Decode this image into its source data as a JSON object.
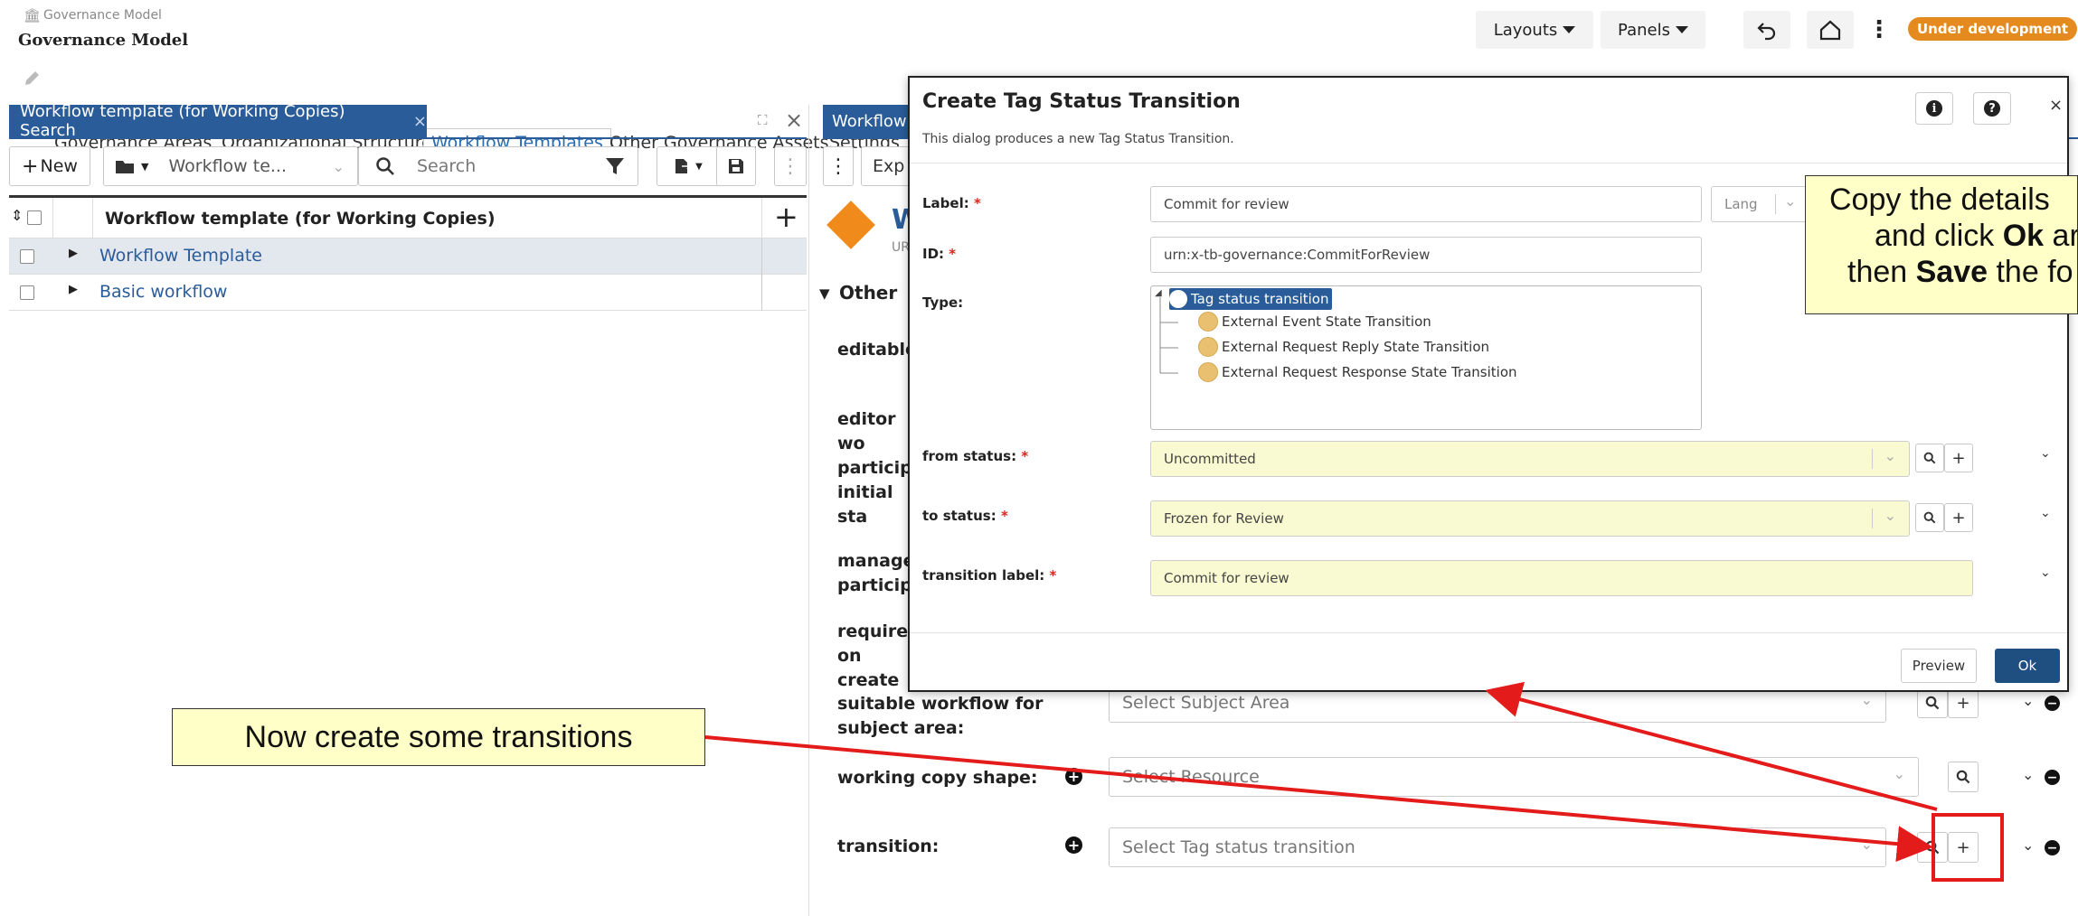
{
  "app": {
    "breadcrumb": "Governance Model",
    "title": "Governance Model",
    "layouts_label": "Layouts",
    "panels_label": "Panels",
    "status_badge": "Under development"
  },
  "tabs": [
    "Governance Areas",
    "Organizational Structure",
    "Workflow Templates",
    "Other Governance Assets",
    "Settings"
  ],
  "left_panel": {
    "tab_title": "Workflow template (for Working Copies) Search",
    "new_label": "New",
    "type_select": "Workflow te...",
    "search_placeholder": "Search",
    "column_header": "Workflow template (for Working Copies)",
    "rows": [
      "Workflow Template",
      "Basic workflow"
    ]
  },
  "right_panel": {
    "tab_title": "Workflow",
    "toolbar_btn": "Exp",
    "resource_initial": "W",
    "resource_sub": "UR",
    "section_title": "Other",
    "fields": [
      {
        "label": "editable",
        "value": ""
      },
      {
        "label": "editor wo participa",
        "value": ""
      },
      {
        "label": "initial sta",
        "value": ""
      },
      {
        "label": "manage participa",
        "value": ""
      },
      {
        "label": "required on create",
        "value": ""
      },
      {
        "label": "suitable workflow for subject area:",
        "value": "Select Subject Area"
      },
      {
        "label": "working copy shape:",
        "value": "Select Resource"
      },
      {
        "label": "transition:",
        "value": "Select Tag status transition"
      }
    ]
  },
  "dialog": {
    "title": "Create Tag Status Transition",
    "subtitle": "This dialog produces a new Tag Status Transition.",
    "label_label": "Label:",
    "label_value": "Commit for review",
    "lang_placeholder": "Lang",
    "id_label": "ID:",
    "id_value": "urn:x-tb-governance:CommitForReview",
    "type_label": "Type:",
    "type_tree": {
      "root": "Tag status transition",
      "children": [
        "External Event State Transition",
        "External Request Reply State Transition",
        "External Request Response State Transition"
      ]
    },
    "from_label": "from status:",
    "from_value": "Uncommitted",
    "to_label": "to status:",
    "to_value": "Frozen for Review",
    "transition_label_label": "transition label:",
    "transition_label_value": "Commit for review",
    "preview_label": "Preview",
    "ok_label": "Ok"
  },
  "callouts": {
    "left": "Now create some transitions",
    "right_line1_pre": "Copy the details",
    "right_line2_pre": "and click ",
    "right_line2_bold": "Ok",
    "right_line2_post": " ar",
    "right_line3_pre": "then ",
    "right_line3_bold": "Save",
    "right_line3_post": " the fo"
  },
  "colors": {
    "tab_header_bg": "#2a5c9a",
    "badge": "#e58a1f",
    "yellow_field": "#fafad2",
    "arrow": "#e31b1b",
    "ok_button": "#1f4e80"
  }
}
